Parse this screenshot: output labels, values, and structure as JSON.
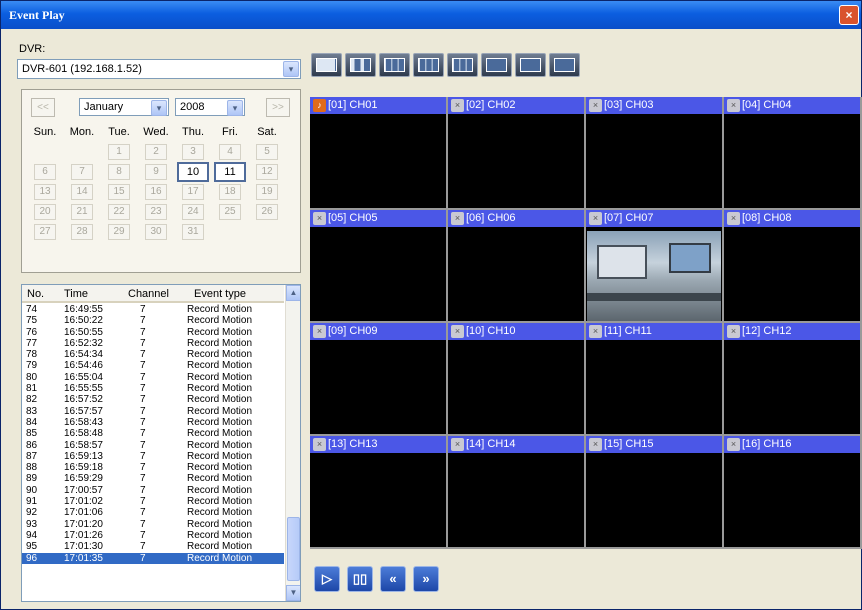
{
  "window": {
    "title": "Event Play",
    "close_glyph": "×"
  },
  "dvr": {
    "label": "DVR:",
    "selected": "DVR-601 (192.168.1.52)",
    "dropdown_icon": "▾"
  },
  "calendar": {
    "prev": "<<",
    "next": ">>",
    "month": "January",
    "year": "2008",
    "weekdays": [
      "Sun.",
      "Mon.",
      "Tue.",
      "Wed.",
      "Thu.",
      "Fri.",
      "Sat."
    ],
    "days": [
      "1",
      "2",
      "3",
      "4",
      "5",
      "6",
      "7",
      "8",
      "9",
      "10",
      "11",
      "12",
      "13",
      "14",
      "15",
      "16",
      "17",
      "18",
      "19",
      "20",
      "21",
      "22",
      "23",
      "24",
      "25",
      "26",
      "27",
      "28",
      "29",
      "30",
      "31"
    ],
    "active_days": [
      "10",
      "11"
    ]
  },
  "events": {
    "columns": [
      "No.",
      "Time",
      "Channel",
      "Event type"
    ],
    "rows": [
      [
        "74",
        "16:49:55",
        "7",
        "Record Motion"
      ],
      [
        "75",
        "16:50:22",
        "7",
        "Record Motion"
      ],
      [
        "76",
        "16:50:55",
        "7",
        "Record Motion"
      ],
      [
        "77",
        "16:52:32",
        "7",
        "Record Motion"
      ],
      [
        "78",
        "16:54:34",
        "7",
        "Record Motion"
      ],
      [
        "79",
        "16:54:46",
        "7",
        "Record Motion"
      ],
      [
        "80",
        "16:55:04",
        "7",
        "Record Motion"
      ],
      [
        "81",
        "16:55:55",
        "7",
        "Record Motion"
      ],
      [
        "82",
        "16:57:52",
        "7",
        "Record Motion"
      ],
      [
        "83",
        "16:57:57",
        "7",
        "Record Motion"
      ],
      [
        "84",
        "16:58:43",
        "7",
        "Record Motion"
      ],
      [
        "85",
        "16:58:48",
        "7",
        "Record Motion"
      ],
      [
        "86",
        "16:58:57",
        "7",
        "Record Motion"
      ],
      [
        "87",
        "16:59:13",
        "7",
        "Record Motion"
      ],
      [
        "88",
        "16:59:18",
        "7",
        "Record Motion"
      ],
      [
        "89",
        "16:59:29",
        "7",
        "Record Motion"
      ],
      [
        "90",
        "17:00:57",
        "7",
        "Record Motion"
      ],
      [
        "91",
        "17:01:02",
        "7",
        "Record Motion"
      ],
      [
        "92",
        "17:01:06",
        "7",
        "Record Motion"
      ],
      [
        "93",
        "17:01:20",
        "7",
        "Record Motion"
      ],
      [
        "94",
        "17:01:26",
        "7",
        "Record Motion"
      ],
      [
        "95",
        "17:01:30",
        "7",
        "Record Motion"
      ],
      [
        "96",
        "17:01:35",
        "7",
        "Record Motion"
      ]
    ],
    "selected_row": "96"
  },
  "layouts": [
    "layout-1",
    "layout-4",
    "layout-6",
    "layout-8",
    "layout-9",
    "layout-10",
    "layout-13",
    "layout-16"
  ],
  "channels": [
    {
      "label": "[01] CH01",
      "audio_on": true
    },
    {
      "label": "[02] CH02"
    },
    {
      "label": "[03] CH03"
    },
    {
      "label": "[04] CH04"
    },
    {
      "label": "[05] CH05"
    },
    {
      "label": "[06] CH06"
    },
    {
      "label": "[07] CH07",
      "has_video": true
    },
    {
      "label": "[08] CH08"
    },
    {
      "label": "[09] CH09"
    },
    {
      "label": "[10] CH10"
    },
    {
      "label": "[11] CH11"
    },
    {
      "label": "[12] CH12"
    },
    {
      "label": "[13] CH13"
    },
    {
      "label": "[14] CH14"
    },
    {
      "label": "[15] CH15"
    },
    {
      "label": "[16] CH16"
    }
  ],
  "playback": [
    {
      "name": "play-button",
      "icon": "play-icon",
      "glyph": "▷"
    },
    {
      "name": "pause-button",
      "icon": "pause-icon",
      "glyph": "▯▯"
    },
    {
      "name": "rewind-button",
      "icon": "rewind-icon",
      "glyph": "«"
    },
    {
      "name": "fast-forward-button",
      "icon": "fast-forward-icon",
      "glyph": "»"
    }
  ],
  "colors": {
    "channel_bar": "#4b57e7",
    "selection": "#316ac5",
    "window_bg": "#ECE9D8"
  }
}
